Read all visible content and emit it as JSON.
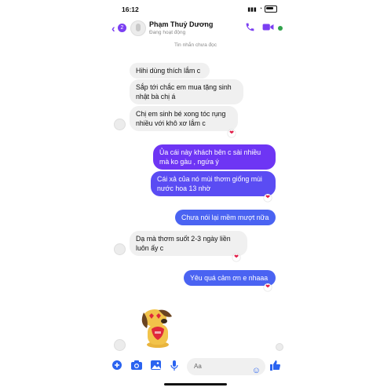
{
  "status": {
    "time": "16:12"
  },
  "header": {
    "back_icon": "chevron-left-icon",
    "unread_count": "2",
    "contact_name": "Phạm Thuỷ Dương",
    "presence": "Đang hoạt động",
    "call_icon": "phone-icon",
    "video_icon": "video-icon"
  },
  "divider": {
    "text": "Tin nhắn chưa đọc"
  },
  "messages": [
    {
      "text": "Hihi dùng thích lắm c"
    },
    {
      "text": "Sắp tới chắc em mua tặng sinh nhật bà chị á"
    },
    {
      "text": "Chị em sinh bé xong tóc rụng nhiều với khô xơ lắm c"
    },
    {
      "text": "Ủa cái này khách bên c sài nhiều mà ko gàu , ngứa ý"
    },
    {
      "text": "Cái xả của nó mùi thơm giống mùi nước hoa 13 nhờ"
    },
    {
      "text": "Chưa nói lại mềm mượt nữa"
    },
    {
      "text": "Dạ mà thơm suốt 2-3 ngày liền luôn ấy c"
    },
    {
      "text": "Yêu quá cảm ơn e nhaaa"
    }
  ],
  "composer": {
    "placeholder": "Aa"
  },
  "colors": {
    "accent": "#7b3ff2",
    "outgoing": "#6e35f4",
    "outgoing_blue": "#4a63f2",
    "incoming": "#f0f0f0"
  }
}
